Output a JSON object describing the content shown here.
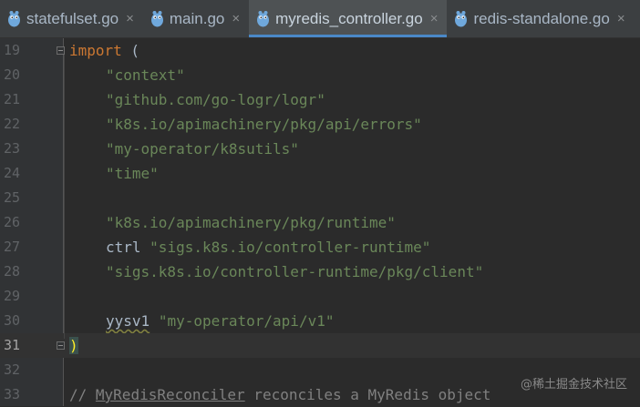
{
  "tabs": [
    {
      "label": "statefulset.go",
      "active": false
    },
    {
      "label": "main.go",
      "active": false
    },
    {
      "label": "myredis_controller.go",
      "active": true
    },
    {
      "label": "redis-standalone.go",
      "active": false
    }
  ],
  "close_glyph": "×",
  "editor": {
    "current_line": 31,
    "lines": [
      {
        "n": "19",
        "kw": "import",
        "rest": " ("
      },
      {
        "n": "20",
        "str": "\"context\""
      },
      {
        "n": "21",
        "str": "\"github.com/go-logr/logr\""
      },
      {
        "n": "22",
        "str": "\"k8s.io/apimachinery/pkg/api/errors\""
      },
      {
        "n": "23",
        "str": "\"my-operator/k8sutils\""
      },
      {
        "n": "24",
        "str": "\"time\""
      },
      {
        "n": "25"
      },
      {
        "n": "26",
        "str": "\"k8s.io/apimachinery/pkg/runtime\""
      },
      {
        "n": "27",
        "alias": "ctrl",
        "str": "\"sigs.k8s.io/controller-runtime\""
      },
      {
        "n": "28",
        "str": "\"sigs.k8s.io/controller-runtime/pkg/client\""
      },
      {
        "n": "29"
      },
      {
        "n": "30",
        "alias": "yysv1",
        "str": "\"my-operator/api/v1\""
      },
      {
        "n": "31",
        "paren": ")"
      },
      {
        "n": "32"
      },
      {
        "n": "33",
        "comment_prefix": "// ",
        "comment_ident": "MyRedisReconciler",
        "comment_rest": " reconciles a MyRedis object"
      }
    ]
  },
  "watermark": "@稀土掘金技术社区"
}
